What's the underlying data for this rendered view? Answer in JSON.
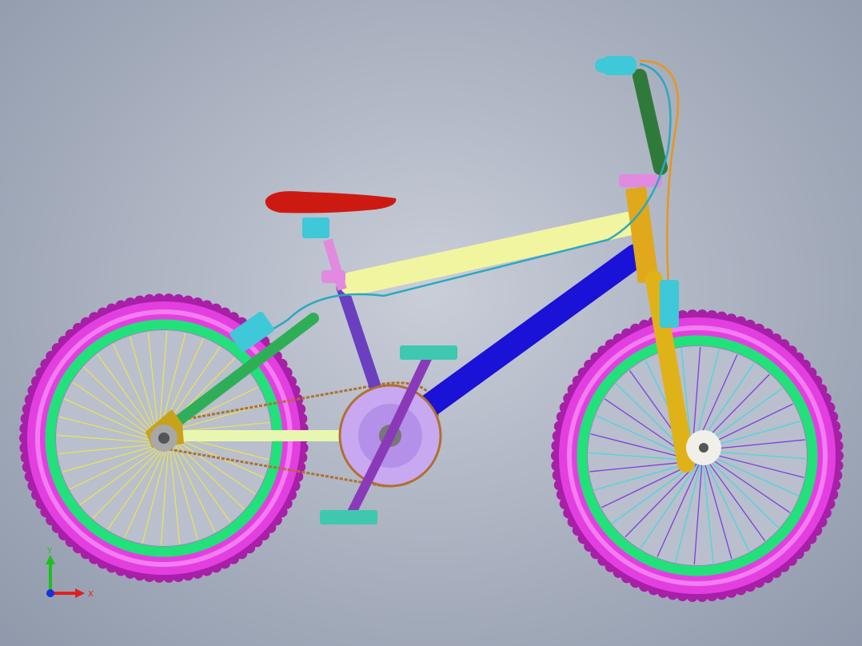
{
  "viewport": {
    "background_top": "#c9ced8",
    "background_bottom": "#8f99ab"
  },
  "model": {
    "colors": {
      "tire": "#e33fe0",
      "tire_dark": "#a81fa8",
      "rim": "#22e07a",
      "spokes_rear": "#e8e25a",
      "spokes_front_a": "#7b3fe0",
      "spokes_front_b": "#49d6e0",
      "top_tube": "#f2f5a0",
      "down_tube": "#1a12d6",
      "seat_tube": "#6a3fc0",
      "seat_stay": "#2fae58",
      "chain_stay": "#e8f7b0",
      "fork": "#e0b21a",
      "head_tube": "#e0a81a",
      "stem_bar": "#2f7a3a",
      "grip": "#3ec8d8",
      "saddle": "#cc1a12",
      "seat_post": "#e08ae0",
      "chainring": "#c8a8f0",
      "crank": "#8a3ab8",
      "dropout": "#c8a21a",
      "brake_cable_a": "#e8961a",
      "brake_cable_b": "#2aa8c0",
      "chain": "#b07030",
      "pedal": "#3ec8b0",
      "rotor": "#f0f0e8"
    }
  },
  "triad": {
    "y_label": "Y",
    "x_label": "X",
    "y_color": "#19c219",
    "x_color": "#e02020",
    "z_color": "#1a2ee0"
  }
}
